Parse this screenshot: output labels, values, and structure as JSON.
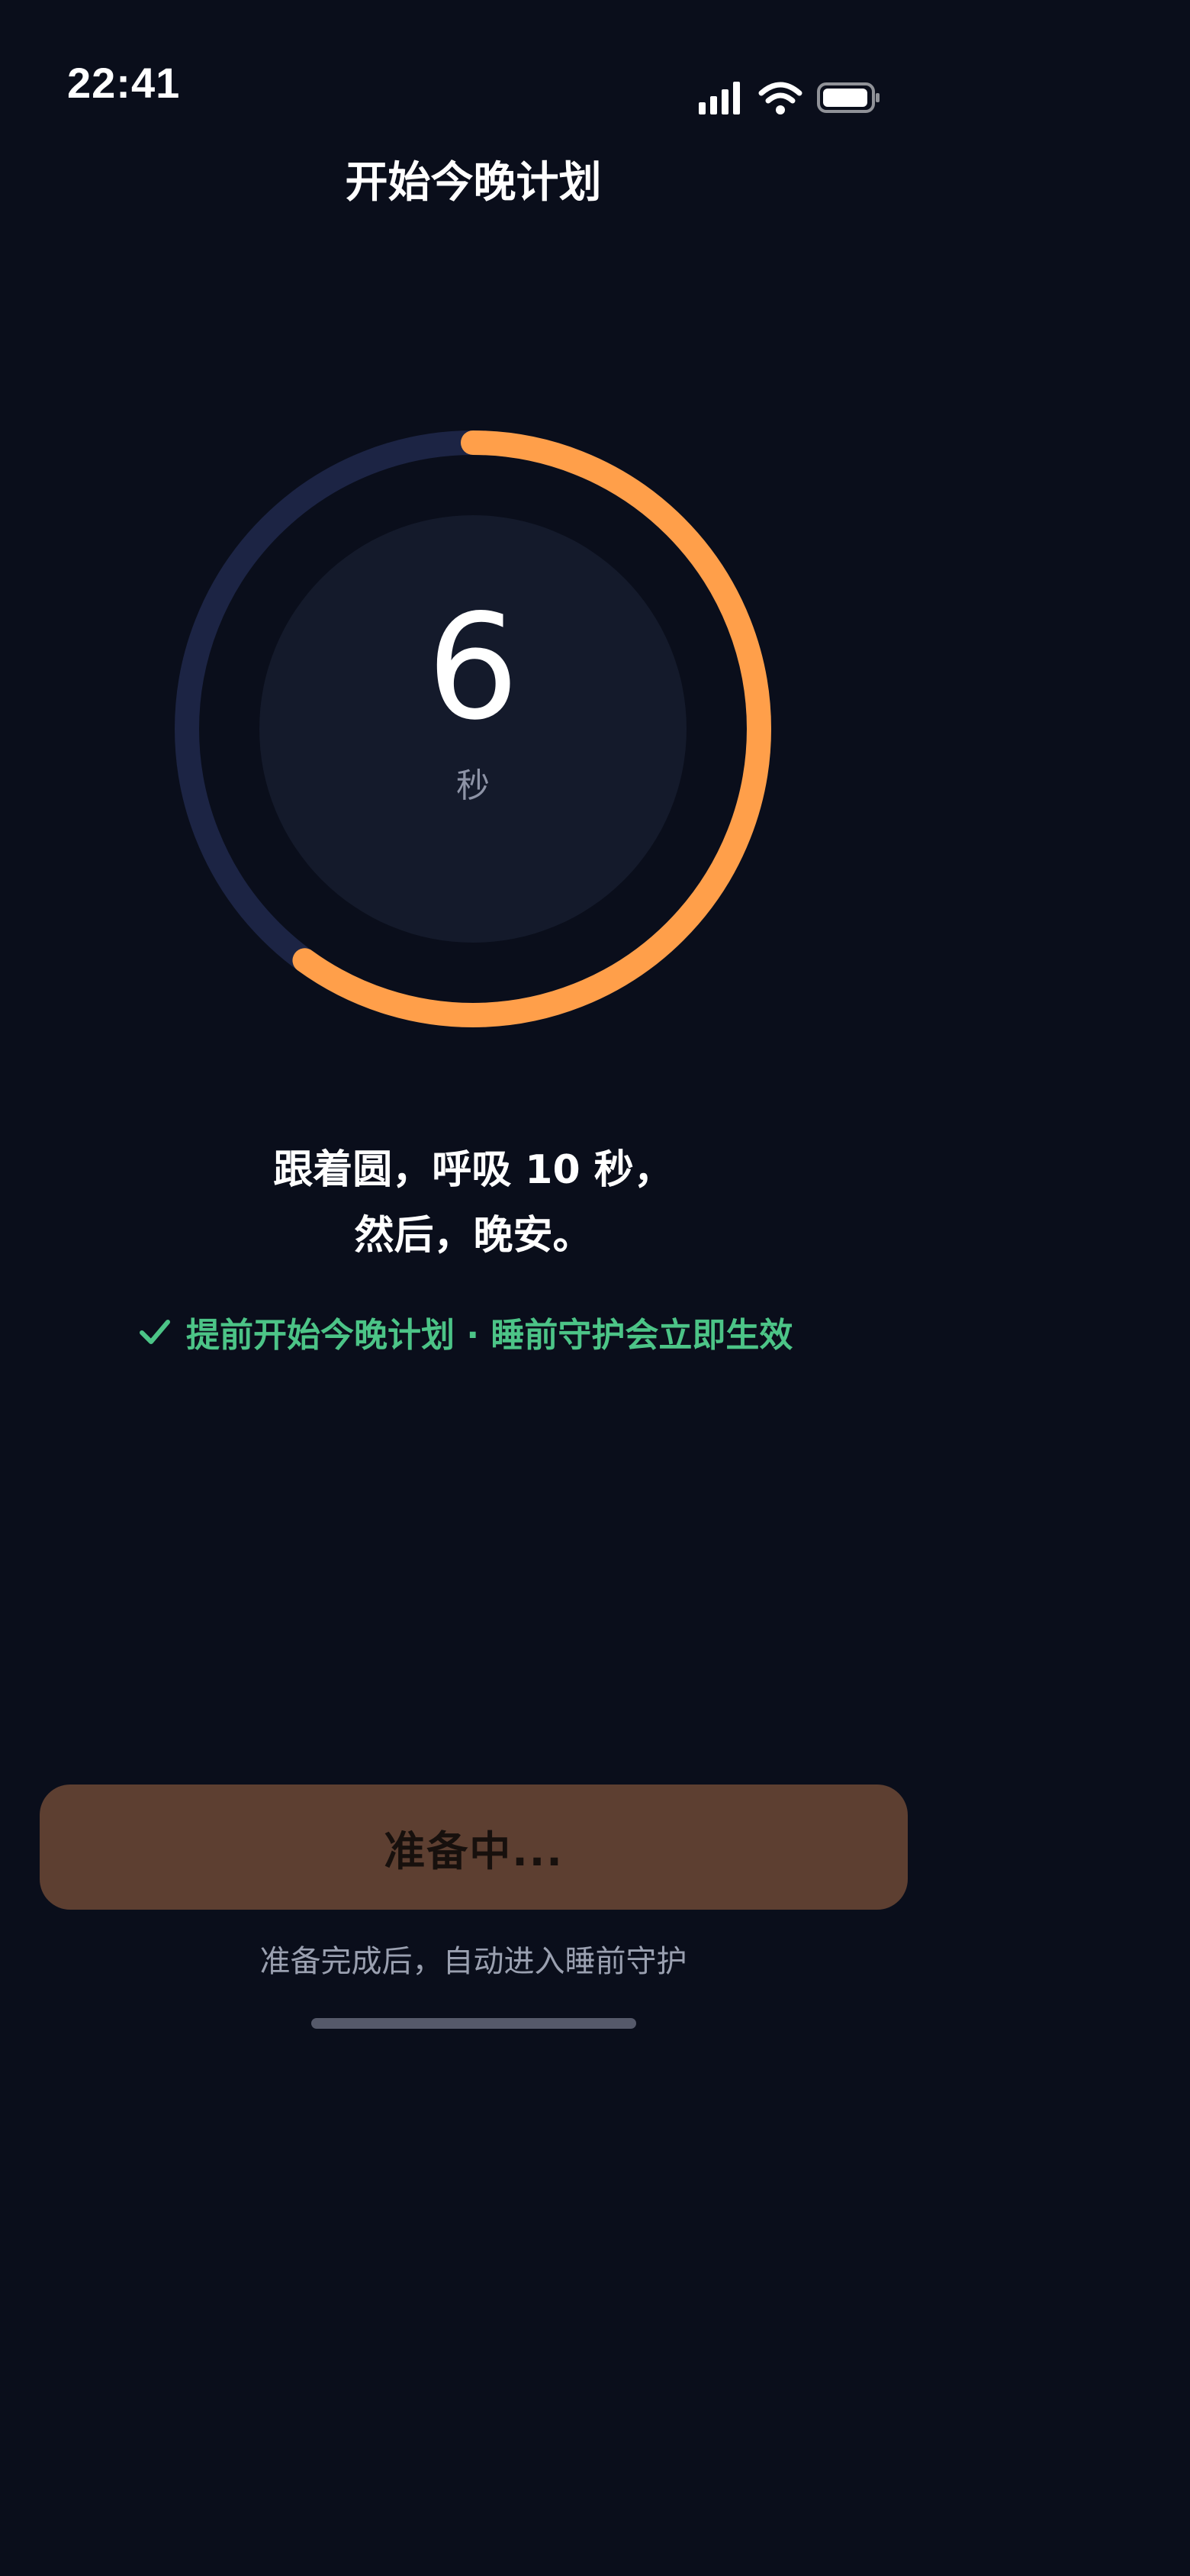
{
  "status_bar": {
    "time": "22:41",
    "icons": [
      "cellular-signal-icon",
      "wifi-icon",
      "battery-icon"
    ]
  },
  "header": {
    "title": "开始今晚计划"
  },
  "countdown": {
    "value": "6",
    "unit": "秒",
    "progress_fraction": 0.6,
    "colors": {
      "progress": "#ff9f4a",
      "track": "#1c2444",
      "inner": "#141a2b"
    }
  },
  "instruction": {
    "line1": "跟着圆，呼吸 10 秒，",
    "line2": "然后，晚安。"
  },
  "notice": {
    "icon": "check-icon",
    "text": "提前开始今晚计划 · 睡前守护会立即生效",
    "color": "#4cc487"
  },
  "primary_button": {
    "label": "准备中..."
  },
  "hint": {
    "text": "准备完成后，自动进入睡前守护"
  }
}
